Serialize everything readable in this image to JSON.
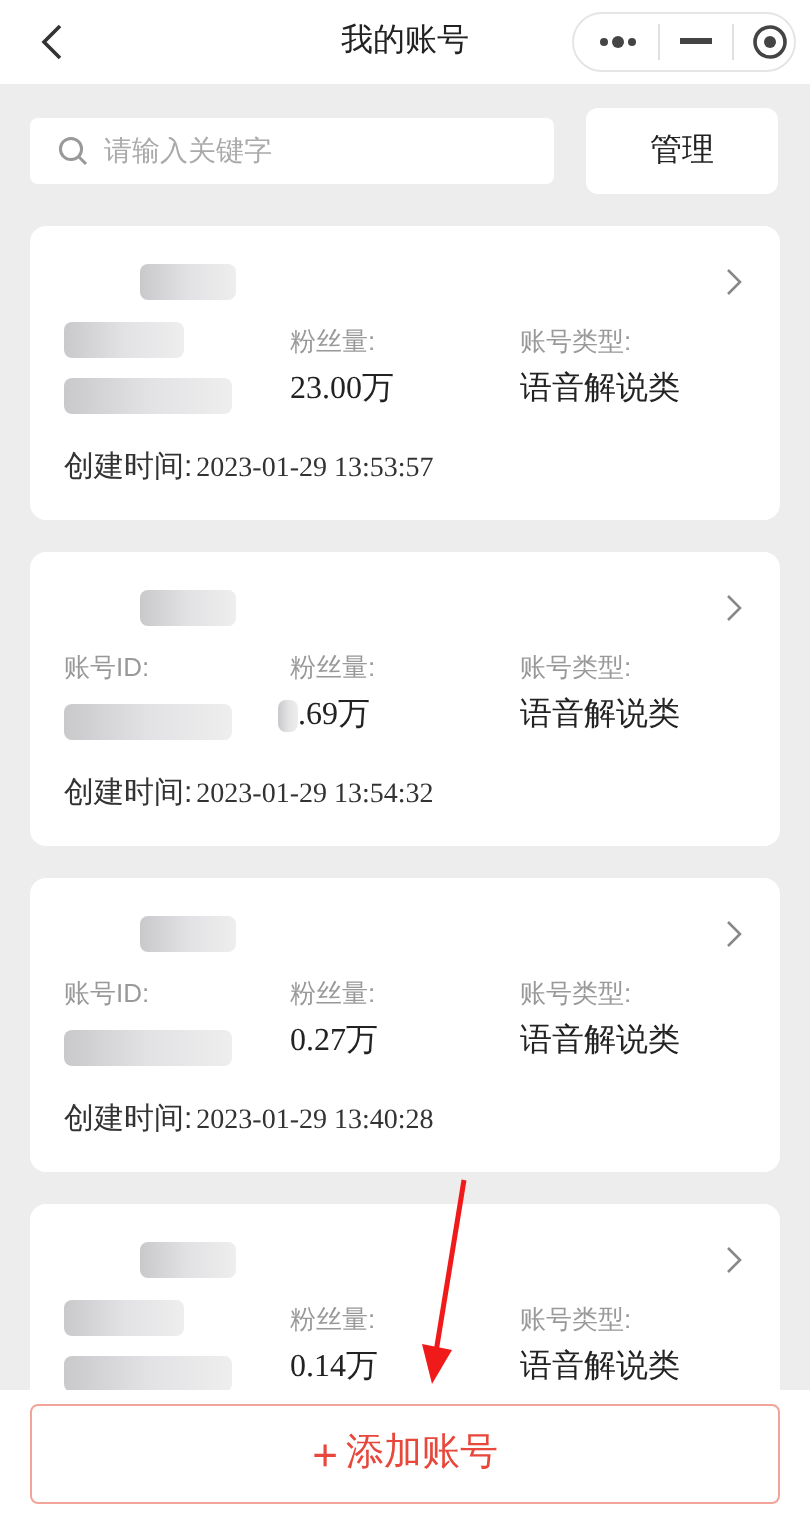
{
  "header": {
    "title": "我的账号"
  },
  "search": {
    "placeholder": "请输入关键字"
  },
  "manage_button": "管理",
  "accounts": [
    {
      "fans_label": "粉丝量:",
      "fans": "23.00万",
      "type_label": "账号类型:",
      "type": "语音解说类",
      "created_label": "创建时间:",
      "created": "2023-01-29 13:53:57"
    },
    {
      "id_label": "账号ID:",
      "fans_label": "粉丝量:",
      "fans": ".69万",
      "fans_partly_hidden": true,
      "type_label": "账号类型:",
      "type": "语音解说类",
      "created_label": "创建时间:",
      "created": "2023-01-29 13:54:32"
    },
    {
      "id_label": "账号ID:",
      "fans_label": "粉丝量:",
      "fans": "0.27万",
      "type_label": "账号类型:",
      "type": "语音解说类",
      "created_label": "创建时间:",
      "created": "2023-01-29 13:40:28"
    },
    {
      "fans_label": "粉丝量:",
      "fans": "0.14万",
      "type_label": "账号类型:",
      "type": "语音解说类"
    }
  ],
  "add_button": {
    "plus": "+",
    "label": "添加账号"
  }
}
